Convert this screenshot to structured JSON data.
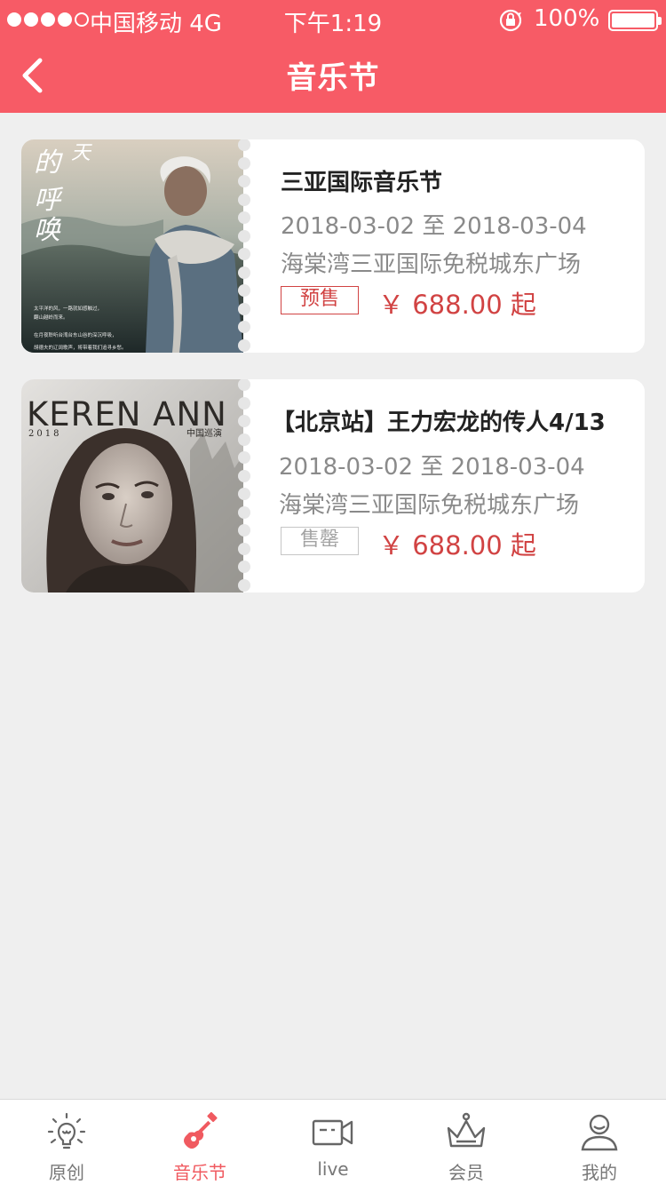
{
  "status_bar": {
    "carrier": "中国移动 4G",
    "time": "下午1:19",
    "battery": "100%"
  },
  "nav": {
    "title": "音乐节"
  },
  "events": [
    {
      "title": "三亚国际音乐节",
      "dates": "2018-03-02 至 2018-03-04",
      "venue": "海棠湾三亚国际免税城东广场",
      "status": "预售",
      "price": "￥ 688.00 起",
      "poster_text": {
        "title_chars": "的天呼唤",
        "caption_lines": [
          "太平洋的风，一路就如感触过，",
          "翻山越岭而来。",
          "在月夜聆听台湾台东山谷的深沉呼吸，",
          "胡德夫的辽阔歌声，将带着我们追寻乡愁。"
        ]
      }
    },
    {
      "title": "【北京站】王力宏龙的传人4/13",
      "dates": "2018-03-02 至 2018-03-04",
      "venue": "海棠湾三亚国际免税城东广场",
      "status": "售罄",
      "price": "￥ 688.00 起",
      "poster_text": {
        "headline": "KEREN ANN",
        "year": "2018",
        "subtitle": "中国巡演"
      }
    }
  ],
  "tabbar": {
    "tabs": [
      {
        "label": "原创",
        "icon": "lightbulb-icon",
        "active": false
      },
      {
        "label": "音乐节",
        "icon": "guitar-icon",
        "active": true
      },
      {
        "label": "live",
        "icon": "video-camera-icon",
        "active": false
      },
      {
        "label": "会员",
        "icon": "crown-icon",
        "active": false
      },
      {
        "label": "我的",
        "icon": "user-icon",
        "active": false
      }
    ]
  },
  "colors": {
    "brand": "#f75b66",
    "price": "#d14343",
    "background": "#efefef"
  }
}
